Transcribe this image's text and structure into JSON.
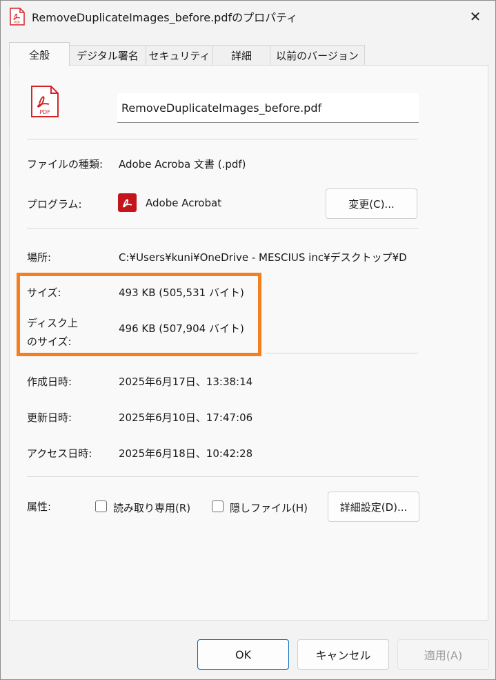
{
  "window": {
    "title": "RemoveDuplicateImages_before.pdfのプロパティ",
    "close_glyph": "✕"
  },
  "tabs": [
    {
      "label": "全般",
      "active": true
    },
    {
      "label": "デジタル署名"
    },
    {
      "label": "セキュリティ"
    },
    {
      "label": "詳細"
    },
    {
      "label": "以前のバージョン"
    }
  ],
  "file": {
    "icon_text": "PDF",
    "name": "RemoveDuplicateImages_before.pdf"
  },
  "props": {
    "type_label": "ファイルの種類:",
    "type_value": "Adobe Acroba 文書 (.pdf)",
    "program_label": "プログラム:",
    "program_value": "Adobe Acrobat",
    "change_button": "変更(C)...",
    "location_label": "場所:",
    "location_value": "C:¥Users¥kuni¥OneDrive - MESCIUS inc¥デスクトップ¥D",
    "size_label": "サイズ:",
    "size_value": "493 KB (505,531 バイト)",
    "disk_size_label_1": "ディスク上",
    "disk_size_label_2": "のサイズ:",
    "disk_size_value": "496 KB (507,904 バイト)",
    "created_label": "作成日時:",
    "created_value": "2025年6月17日、13:38:14",
    "modified_label": "更新日時:",
    "modified_value": "2025年6月10日、17:47:06",
    "accessed_label": "アクセス日時:",
    "accessed_value": "2025年6月18日、10:42:28",
    "attributes_label": "属性:",
    "readonly_label": "読み取り専用(R)",
    "readonly_checked": false,
    "hidden_label": "隠しファイル(H)",
    "hidden_checked": false,
    "advanced_button": "詳細設定(D)..."
  },
  "footer": {
    "ok": "OK",
    "cancel": "キャンセル",
    "apply": "適用(A)",
    "apply_enabled": false
  },
  "colors": {
    "highlight": "#f47f20",
    "pdf_red": "#d4242a",
    "ok_border": "#0067c0"
  }
}
